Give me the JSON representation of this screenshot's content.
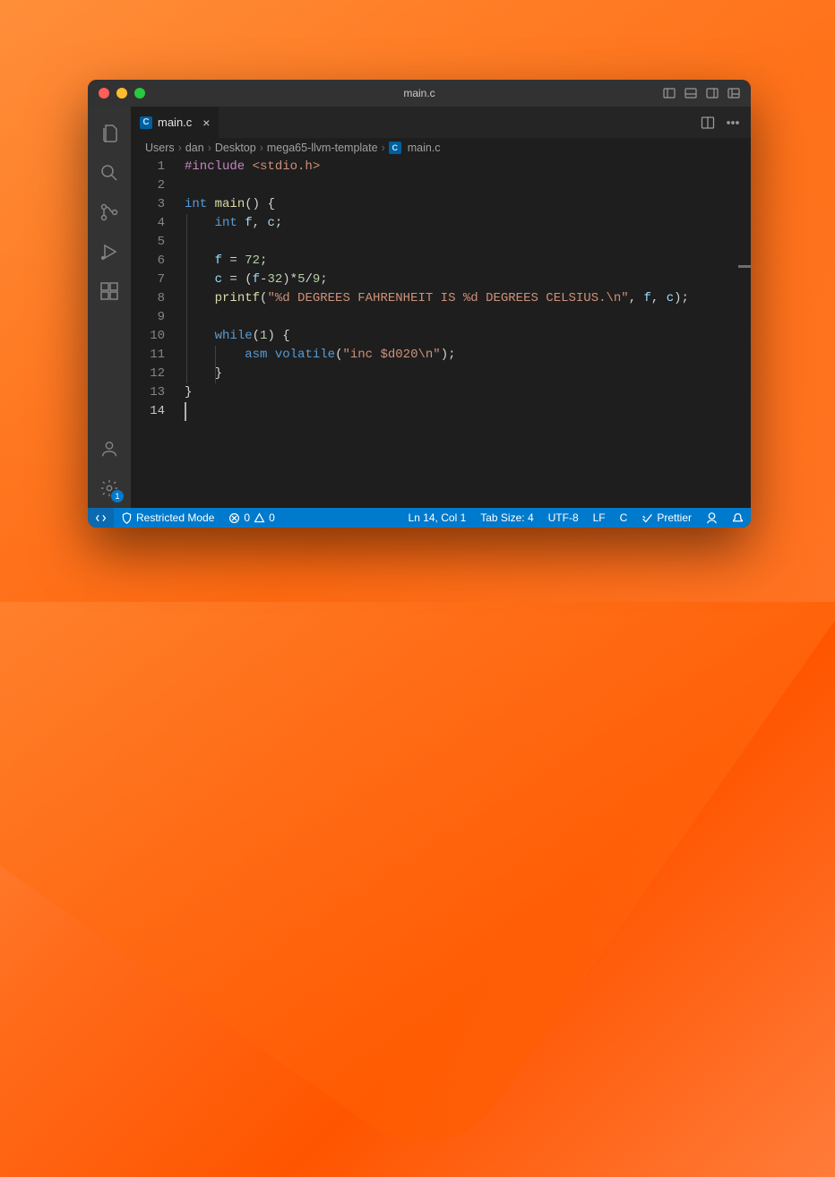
{
  "window": {
    "title": "main.c"
  },
  "tab": {
    "filename": "main.c",
    "lang_badge": "C"
  },
  "breadcrumb": {
    "parts": [
      "Users",
      "dan",
      "Desktop",
      "mega65-llvm-template"
    ],
    "file_badge": "C",
    "file": "main.c"
  },
  "activitybar": {
    "settings_badge": "1"
  },
  "editor": {
    "line_count": 14,
    "current_line": 14,
    "lines": [
      {
        "n": 1,
        "html": "<span class='pp'>#include</span> <span class='st'>&lt;stdio.h&gt;</span>"
      },
      {
        "n": 2,
        "html": ""
      },
      {
        "n": 3,
        "html": "<span class='ty'>int</span> <span class='fn'>main</span>() {"
      },
      {
        "n": 4,
        "html": "    <span class='ty'>int</span> <span class='vr'>f</span>, <span class='vr'>c</span>;"
      },
      {
        "n": 5,
        "html": ""
      },
      {
        "n": 6,
        "html": "    <span class='vr'>f</span> = <span class='nm'>72</span>;"
      },
      {
        "n": 7,
        "html": "    <span class='vr'>c</span> = (<span class='vr'>f</span>-<span class='nm'>32</span>)*<span class='nm'>5</span>/<span class='nm'>9</span>;"
      },
      {
        "n": 8,
        "html": "    <span class='fn'>printf</span>(<span class='st'>\"%d DEGREES FAHRENHEIT IS %d DEGREES CELSIUS.\\n\"</span>, <span class='vr'>f</span>, <span class='vr'>c</span>);"
      },
      {
        "n": 9,
        "html": ""
      },
      {
        "n": 10,
        "html": "    <span class='kw'>while</span>(<span class='nm'>1</span>) {"
      },
      {
        "n": 11,
        "html": "        <span class='kw'>asm</span> <span class='kw'>volatile</span>(<span class='st'>\"inc $d020\\n\"</span>);"
      },
      {
        "n": 12,
        "html": "    }"
      },
      {
        "n": 13,
        "html": "}"
      },
      {
        "n": 14,
        "html": ""
      }
    ]
  },
  "status": {
    "restricted": "Restricted Mode",
    "errors": "0",
    "warnings": "0",
    "cursor": "Ln 14, Col 1",
    "tabsize": "Tab Size: 4",
    "encoding": "UTF-8",
    "eol": "LF",
    "lang": "C",
    "formatter": "Prettier"
  }
}
